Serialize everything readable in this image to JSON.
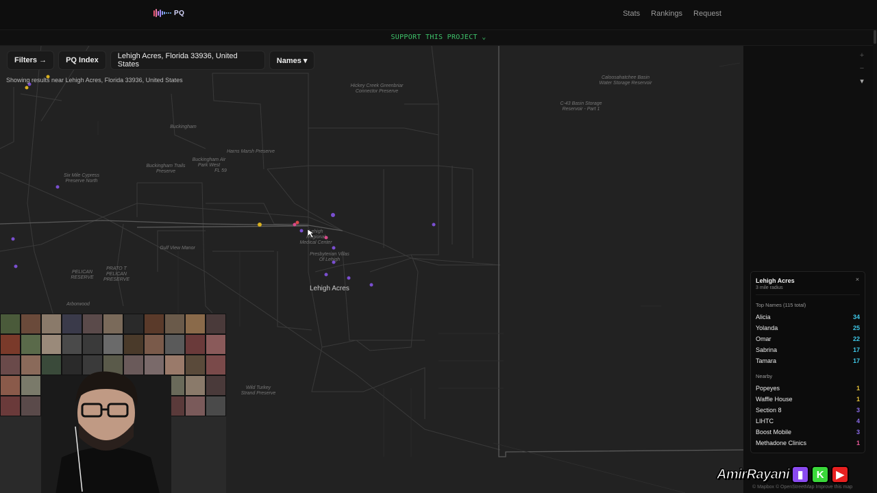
{
  "header": {
    "logo_text": "PQ",
    "nav": [
      "Stats",
      "Rankings",
      "Request"
    ]
  },
  "support_banner": "SUPPORT THIS PROJECT ⌄",
  "toolbar": {
    "filters_label": "Filters →",
    "index_label": "PQ Index",
    "location_value": "Lehigh Acres, Florida 33936, United States",
    "names_label": "Names ▾"
  },
  "showing_text": "Showing results near Lehigh Acres, Florida 33936, United States",
  "map": {
    "city_label": "Lehigh Acres",
    "labels": [
      "Hickey Creek Greenbriar Connector Preserve",
      "Caloosahatchee Basin Water Storage Reservoir",
      "C-43 Basin Storage Reservoir - Part 1",
      "Buckingham",
      "Harns Marsh Preserve",
      "Buckingham Air Park West",
      "FL 59",
      "Buckingham Trails Preserve",
      "Six Mile Cypress Preserve North",
      "Gulf View Manor",
      "PRATO T PELICAN PRESERVE",
      "PELICAN RESERVE",
      "Arborwood",
      "Wild Turkey Strand Preserve",
      "Lehigh Regional Medical Center",
      "Presbyterian Villas Of Lehigh"
    ],
    "attribution": "© Mapbox © OpenStreetMap Improve this map",
    "zoom_in": "+",
    "zoom_out": "−",
    "compass": "▾"
  },
  "panel": {
    "title": "Lehigh Acres",
    "subtitle": "3 mile radius",
    "close": "×",
    "top_names_title": "Top Names (115 total)",
    "top_names": [
      {
        "name": "Alicia",
        "count": "34"
      },
      {
        "name": "Yolanda",
        "count": "25"
      },
      {
        "name": "Omar",
        "count": "22"
      },
      {
        "name": "Sabrina",
        "count": "17"
      },
      {
        "name": "Tamara",
        "count": "17"
      }
    ],
    "nearby_title": "Nearby",
    "nearby": [
      {
        "name": "Popeyes",
        "count": "1"
      },
      {
        "name": "Waffle House",
        "count": "1"
      },
      {
        "name": "Section 8",
        "count": "3"
      },
      {
        "name": "LIHTC",
        "count": "4"
      },
      {
        "name": "Boost Mobile",
        "count": "3"
      },
      {
        "name": "Methadone Clinics",
        "count": "1"
      }
    ]
  },
  "colors": {
    "accent_cyan": "#3fc8e8",
    "accent_green": "#3ec26a",
    "nearby_yellow": "#e8c43a",
    "nearby_purple": "#8a6be8",
    "nearby_pink": "#e85a9a",
    "marker_purple": "#7a4fd0",
    "marker_yellow": "#d8b020"
  },
  "watermark": {
    "name": "AmirRayani",
    "icons": [
      "twitch-icon",
      "kick-icon",
      "youtube-icon"
    ]
  }
}
